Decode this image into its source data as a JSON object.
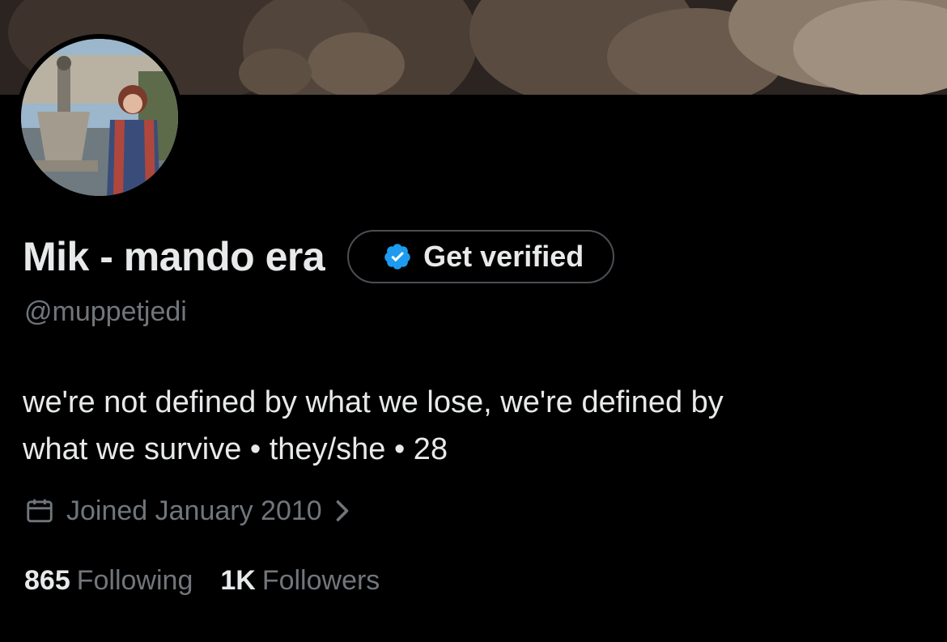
{
  "profile": {
    "display_name": "Mik - mando era",
    "handle": "@muppetjedi",
    "bio_lines": [
      "we're not defined by what we lose, we're defined by",
      "what we survive • they/she • 28"
    ],
    "joined": "Joined January 2010"
  },
  "verify": {
    "label": "Get verified",
    "badge_icon": "verified-badge-icon",
    "badge_color": "#1d9bf0"
  },
  "stats": {
    "following_count": "865",
    "following_label": "Following",
    "followers_count": "1K",
    "followers_label": "Followers"
  },
  "icons": {
    "calendar": "calendar-icon",
    "chevron": "chevron-right-icon"
  },
  "colors": {
    "background": "#000000",
    "primary_text": "#e7e9ea",
    "secondary_text": "#71767b",
    "border": "#4a4f54"
  }
}
